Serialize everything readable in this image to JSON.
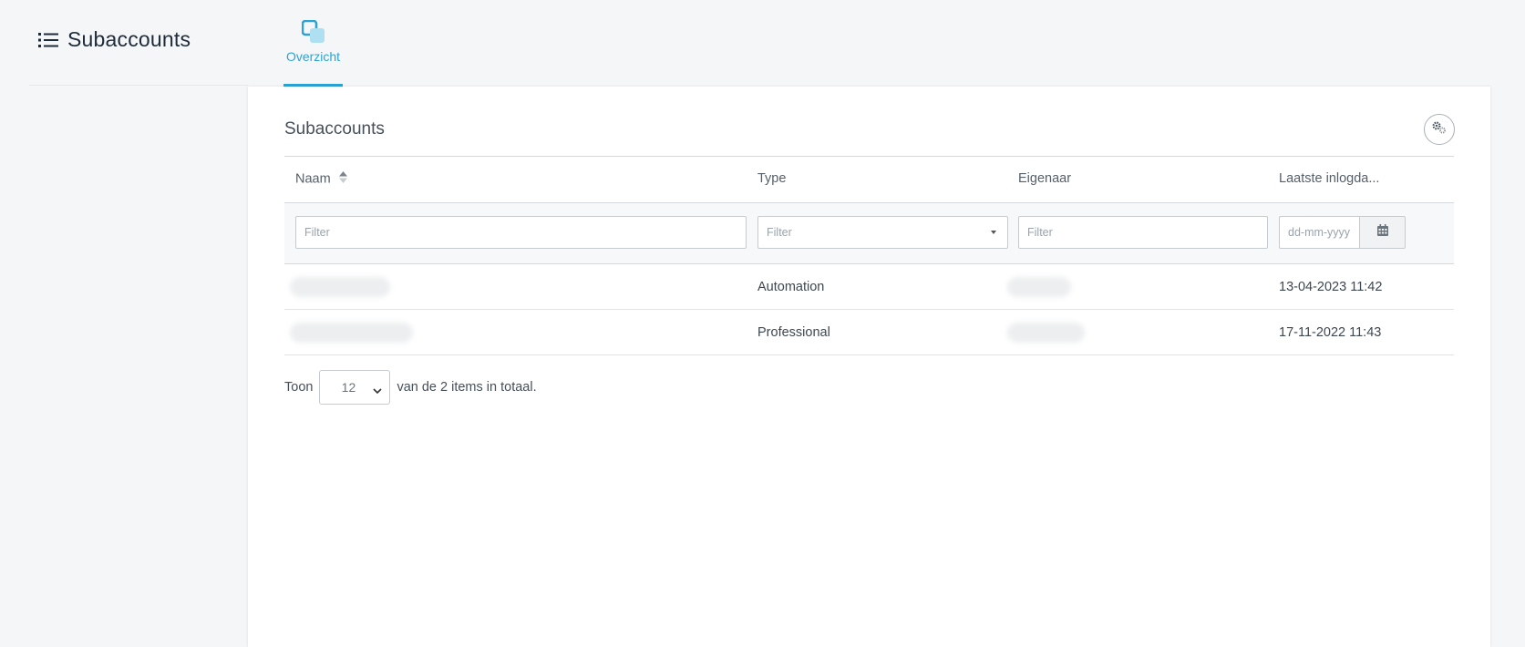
{
  "header": {
    "title": "Subaccounts",
    "tabs": [
      {
        "label": "Overzicht",
        "active": true
      }
    ]
  },
  "card": {
    "title": "Subaccounts",
    "columns": {
      "naam": "Naam",
      "type": "Type",
      "eigenaar": "Eigenaar",
      "laatste": "Laatste inlogda..."
    },
    "filters": {
      "naam_placeholder": "Filter",
      "type_placeholder": "Filter",
      "eigenaar_placeholder": "Filter",
      "date_placeholder": "dd-mm-yyyy"
    },
    "rows": [
      {
        "type": "Automation",
        "last_login": "13-04-2023 11:42"
      },
      {
        "type": "Professional",
        "last_login": "17-11-2022 11:43"
      }
    ],
    "pager": {
      "prefix": "Toon",
      "page_size": "12",
      "suffix": "van de 2 items in totaal."
    }
  },
  "colors": {
    "accent": "#2aa4d5",
    "title": "#1d2b3a",
    "border": "#d5d9dd"
  },
  "icons": {
    "title": "list-icon",
    "tab": "overview-squares-icon",
    "settings": "gears-icon",
    "sort": "sort-icon",
    "calendar": "calendar-icon"
  }
}
